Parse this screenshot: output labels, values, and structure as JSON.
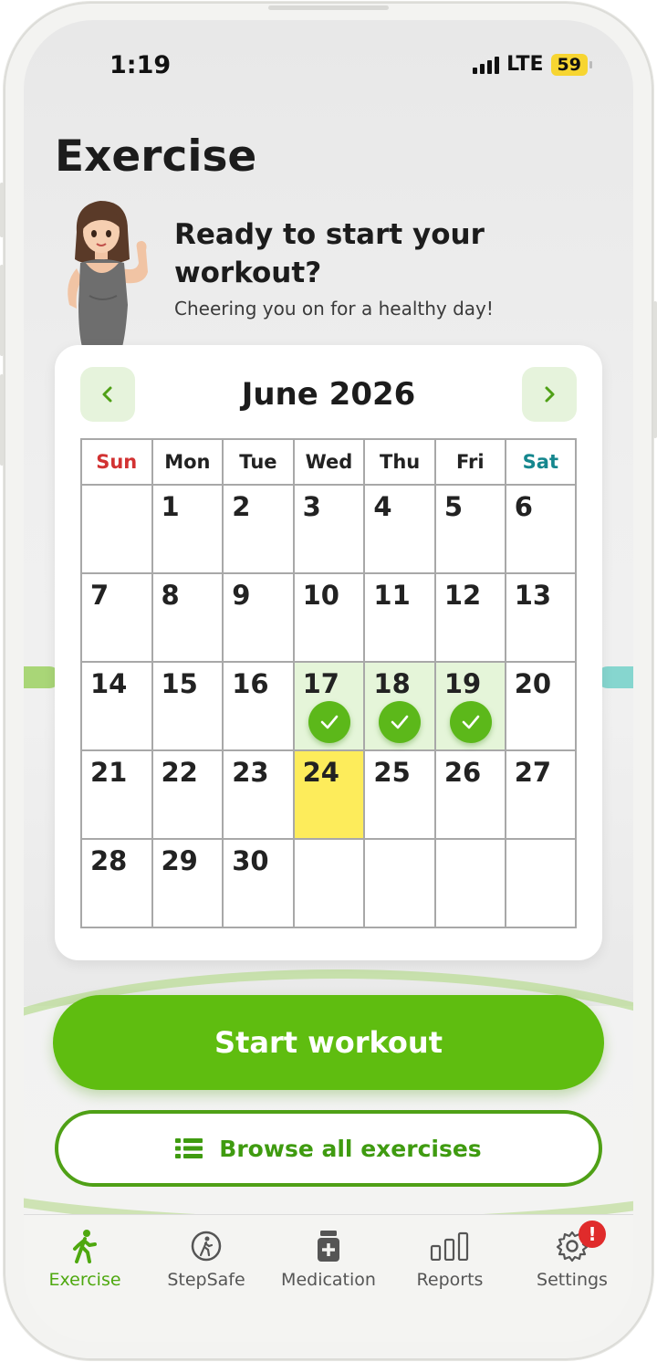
{
  "status": {
    "time": "1:19",
    "network": "LTE",
    "battery": "59"
  },
  "header": {
    "title": "Exercise"
  },
  "greeting": {
    "title": "Ready to start your workout?",
    "subtitle": "Cheering you on for a healthy day!"
  },
  "calendar": {
    "month_label": "June 2026",
    "weekdays": [
      "Sun",
      "Mon",
      "Tue",
      "Wed",
      "Thu",
      "Fri",
      "Sat"
    ],
    "weeks": [
      [
        "",
        "1",
        "2",
        "3",
        "4",
        "5",
        "6"
      ],
      [
        "7",
        "8",
        "9",
        "10",
        "11",
        "12",
        "13"
      ],
      [
        "14",
        "15",
        "16",
        "17",
        "18",
        "19",
        "20"
      ],
      [
        "21",
        "22",
        "23",
        "24",
        "25",
        "26",
        "27"
      ],
      [
        "28",
        "29",
        "30",
        "",
        "",
        "",
        ""
      ]
    ],
    "completed_days": [
      "17",
      "18",
      "19"
    ],
    "today": "24"
  },
  "actions": {
    "start_label": "Start workout",
    "browse_label": "Browse all exercises"
  },
  "tabs": [
    {
      "label": "Exercise",
      "icon": "walking-person-icon",
      "active": true
    },
    {
      "label": "StepSafe",
      "icon": "walking-circle-icon",
      "active": false
    },
    {
      "label": "Medication",
      "icon": "medicine-bottle-icon",
      "active": false
    },
    {
      "label": "Reports",
      "icon": "bar-chart-icon",
      "active": false
    },
    {
      "label": "Settings",
      "icon": "gear-icon",
      "active": false,
      "badge": "!"
    }
  ],
  "colors": {
    "accent": "#5fbd10",
    "completed_day": "#e5f5d9",
    "today": "#fdec5b",
    "sunday": "#d23232",
    "saturday": "#15878e",
    "badge": "#e02b2b"
  }
}
